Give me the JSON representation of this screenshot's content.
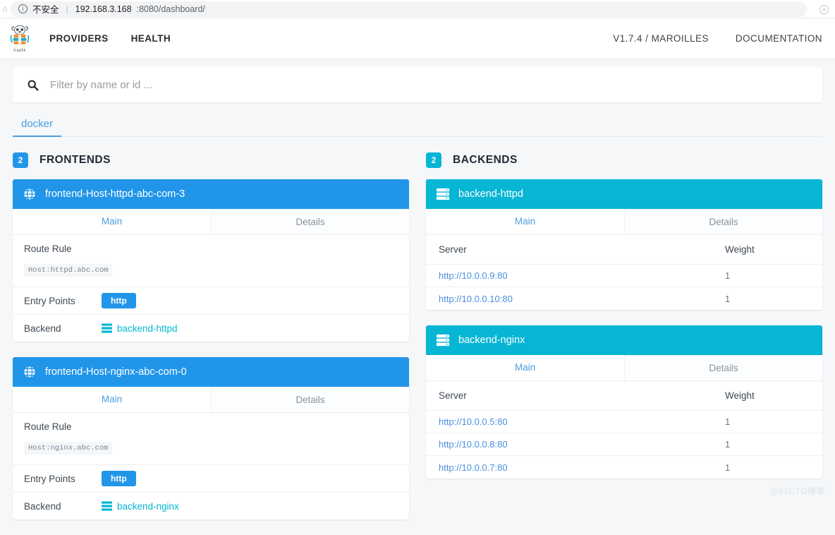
{
  "browser": {
    "security_label": "不安全",
    "url_host": "192.168.3.168",
    "url_path": ":8080/dashboard/",
    "info_glyph": "i"
  },
  "navbar": {
    "logo_word": "traefik",
    "left_links": [
      {
        "label": "PROVIDERS",
        "name": "nav-providers"
      },
      {
        "label": "HEALTH",
        "name": "nav-health"
      }
    ],
    "version": "V1.7.4 / MAROILLES",
    "documentation": "DOCUMENTATION"
  },
  "search": {
    "placeholder": "Filter by name or id ...",
    "value": ""
  },
  "provider_tabs": [
    {
      "label": "docker",
      "active": true
    }
  ],
  "colors": {
    "frontend_badge": "#2196e9",
    "backend_badge": "#06b6d4",
    "accent_blue": "#4a9fe0",
    "accent_cyan": "#06b6d4"
  },
  "frontends": {
    "count": "2",
    "title": "FRONTENDS",
    "tab_main": "Main",
    "tab_details": "Details",
    "label_route_rule": "Route Rule",
    "label_entry_points": "Entry Points",
    "label_backend": "Backend",
    "items": [
      {
        "name": "frontend-Host-httpd-abc-com-3",
        "route_rule": "Host:httpd.abc.com",
        "entry_point": "http",
        "backend": "backend-httpd"
      },
      {
        "name": "frontend-Host-nginx-abc-com-0",
        "route_rule": "Host:nginx.abc.com",
        "entry_point": "http",
        "backend": "backend-nginx"
      }
    ]
  },
  "backends": {
    "count": "2",
    "title": "BACKENDS",
    "tab_main": "Main",
    "tab_details": "Details",
    "col_server": "Server",
    "col_weight": "Weight",
    "items": [
      {
        "name": "backend-httpd",
        "servers": [
          {
            "url": "http://10.0.0.9:80",
            "weight": "1"
          },
          {
            "url": "http://10.0.0.10:80",
            "weight": "1"
          }
        ]
      },
      {
        "name": "backend-nginx",
        "servers": [
          {
            "url": "http://10.0.0.5:80",
            "weight": "1"
          },
          {
            "url": "http://10.0.0.8:80",
            "weight": "1"
          },
          {
            "url": "http://10.0.0.7:80",
            "weight": "1"
          }
        ]
      }
    ]
  },
  "watermark": "@51CTO博客"
}
